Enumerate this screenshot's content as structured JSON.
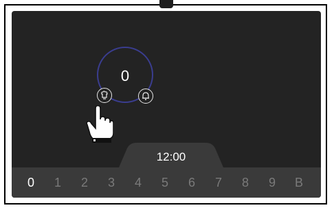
{
  "timer": {
    "value": "0"
  },
  "clock": {
    "time": "12:00"
  },
  "number_bar": {
    "items": [
      "0",
      "1",
      "2",
      "3",
      "4",
      "5",
      "6",
      "7",
      "8",
      "9",
      "B"
    ],
    "selected": "0"
  },
  "colors": {
    "ring": "#3a3d8f",
    "background": "#232323",
    "bar": "#3a3a3a"
  },
  "icons": {
    "left_button": "kitchen-timer-icon",
    "right_button": "bell-icon",
    "pointer": "pointing-hand-icon"
  }
}
